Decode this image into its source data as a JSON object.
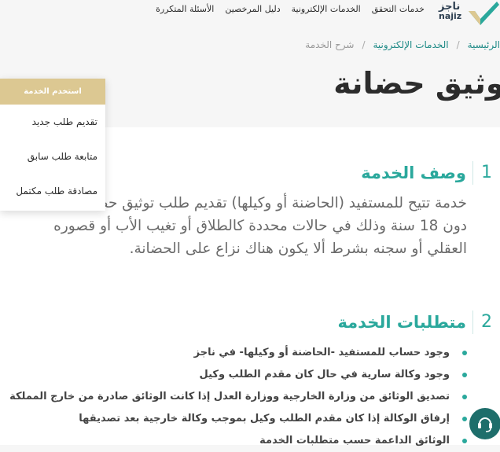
{
  "nav": {
    "links": [
      "خدمات التحقق",
      "الخدمات الإلكترونية",
      "دليل المرخصين",
      "الأسئلة المتكررة"
    ],
    "logo_ar": "ناجز",
    "logo_en": "najiz",
    "brand_color": "#2aa89c"
  },
  "breadcrumb": {
    "home": "الرئيسية",
    "section": "الخدمات الإلكترونية",
    "current": "شرح الخدمة"
  },
  "page": {
    "title": "توثيق حضانة"
  },
  "service_menu": {
    "header": "استخدم الخدمة",
    "items": [
      "تقديم طلب جديد",
      "متابعة طلب سابق",
      "مصادقة طلب مكتمل"
    ]
  },
  "description": {
    "number": "1",
    "title": "وصف الخدمة",
    "lines": [
      "خدمة تتيح للمستفيد (الحاضنة أو وكيلها) تقديم طلب توثيق حضانة",
      "دون 18 سنة وذلك في حالات محددة كالطلاق أو تغيب الأب أو قصوره",
      "العقلي أو سجنه بشرط ألا يكون هناك نزاع على الحضانة."
    ]
  },
  "requirements": {
    "number": "2",
    "title": "متطلبات الخدمة",
    "items": [
      "وجود حساب للمستفيد -الحاضنة أو وكيلها- في ناجز",
      "وجود وكالة سارية في حال كان مقدم الطلب وكيل",
      "تصديق الوثائق من وزارة الخارجية ووزارة العدل إذا كانت الوثائق صادرة من خارج المملكة",
      "إرفاق الوكالة إذا كان مقدم الطلب وكيل بموجب وكالة خارجية بعد تصديقها",
      "الوثائق الداعمة حسب متطلبات الخدمة"
    ]
  }
}
